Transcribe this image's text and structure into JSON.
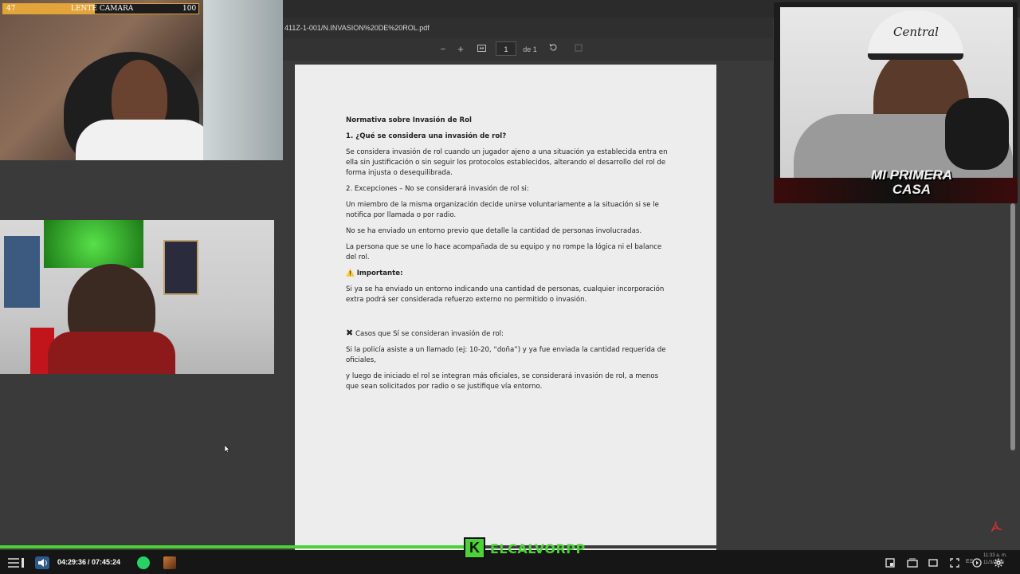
{
  "stream": {
    "cam_bar": {
      "left_value": "47",
      "label": "LENTE CAMARA",
      "right_value": "100",
      "fill_fraction": 0.47
    }
  },
  "pdf_viewer": {
    "filename": "411Z-1-001/N.INVASION%20DE%20ROL.pdf",
    "toolbar": {
      "zoom_out": "−",
      "zoom_in": "+",
      "page_current": "1",
      "page_total": "de 1"
    }
  },
  "document": {
    "title": "Normativa sobre Invasión de Rol",
    "heading1": "1. ¿Qué se considera una invasión de rol?",
    "para1": " Se considera invasión de rol cuando un jugador ajeno a una situación ya establecida entra en ella sin justificación o sin seguir los protocolos establecidos, alterando el desarrollo del rol de forma injusta o desequilibrada.",
    "heading2": "2. Excepciones – No se considerará invasión de rol si:",
    "exc1": "Un miembro de la misma organización decide unirse voluntariamente a la situación  si se le notifica por llamada o por radio.",
    "exc2": "No se ha enviado un entorno previo que detalle la cantidad de personas involucradas.",
    "exc3": "La persona que se une lo hace acompañada de su equipo y no rompe la lógica ni el balance del rol.",
    "important_icon": "⚠️",
    "important_label": "Importante:",
    "important_text": " Si ya se ha enviado un entorno indicando una cantidad de personas, cualquier incorporación extra podrá ser considerada refuerzo externo no permitido o invasión.",
    "cases_icon": "✖",
    "cases_heading": "Casos que Sí se consideran invasión de rol:",
    "case1": "Si la policía asiste a un llamado (ej: 10-20, “doña”) y ya fue enviada la cantidad requerida de oficiales,",
    "case2": " y luego de iniciado el rol se integran más oficiales, se considerará invasión de rol, a menos que sean solicitados por radio o se justifique vía entorno."
  },
  "overlay": {
    "brand_letter": "K",
    "brand_name": "ELCALVORPP",
    "cam3_text": "MI PRIMERA CASA",
    "cap_text": "Central",
    "progress_fraction": 0.46
  },
  "taskbar": {
    "elapsed": "04:29:36",
    "total": "/ 07:45:24",
    "clock": "11:33 a. m.",
    "date": "11/3/2025",
    "lang": "ES"
  },
  "colors": {
    "accent_green": "#4cd137",
    "bar_orange": "#e3a53a"
  }
}
